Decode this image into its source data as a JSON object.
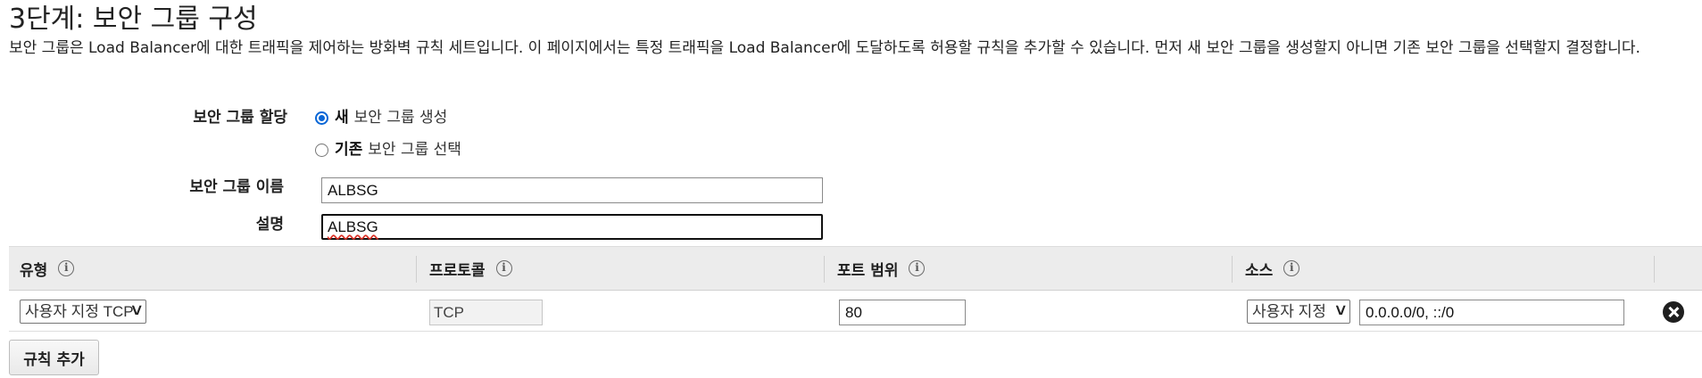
{
  "page": {
    "title": "3단계: 보안 그룹 구성",
    "description": "보안 그룹은 Load Balancer에 대한 트래픽을 제어하는 방화벽 규칙 세트입니다. 이 페이지에서는 특정 트래픽을 Load Balancer에 도달하도록 허용할 규칙을 추가할 수 있습니다. 먼저 새 보안 그룹을 생성할지 아니면 기존 보안 그룹을 선택할지 결정합니다."
  },
  "form": {
    "assign_label": "보안 그룹 할당",
    "options": [
      {
        "strong": "새",
        "rest": "보안 그룹 생성",
        "checked": true
      },
      {
        "strong": "기존",
        "rest": "보안 그룹 선택",
        "checked": false
      }
    ],
    "name_label": "보안 그룹 이름",
    "name_value": "ALBSG",
    "desc_label": "설명",
    "desc_value": "ALBSG"
  },
  "table": {
    "headers": {
      "type": "유형",
      "protocol": "프로토콜",
      "port_range": "포트 범위",
      "source": "소스"
    },
    "rows": [
      {
        "type": "사용자 지정 TCP",
        "protocol": "TCP",
        "port_range": "80",
        "source_type": "사용자 지정",
        "source_value": "0.0.0.0/0, ::/0"
      }
    ]
  },
  "actions": {
    "add_rule": "규칙 추가"
  },
  "icons": {
    "info": "info-icon",
    "remove": "remove-circle-icon",
    "dropdown": "chevron-down-icon"
  },
  "colors": {
    "radio_accent": "#0a66d6",
    "header_bg": "#ececec"
  }
}
